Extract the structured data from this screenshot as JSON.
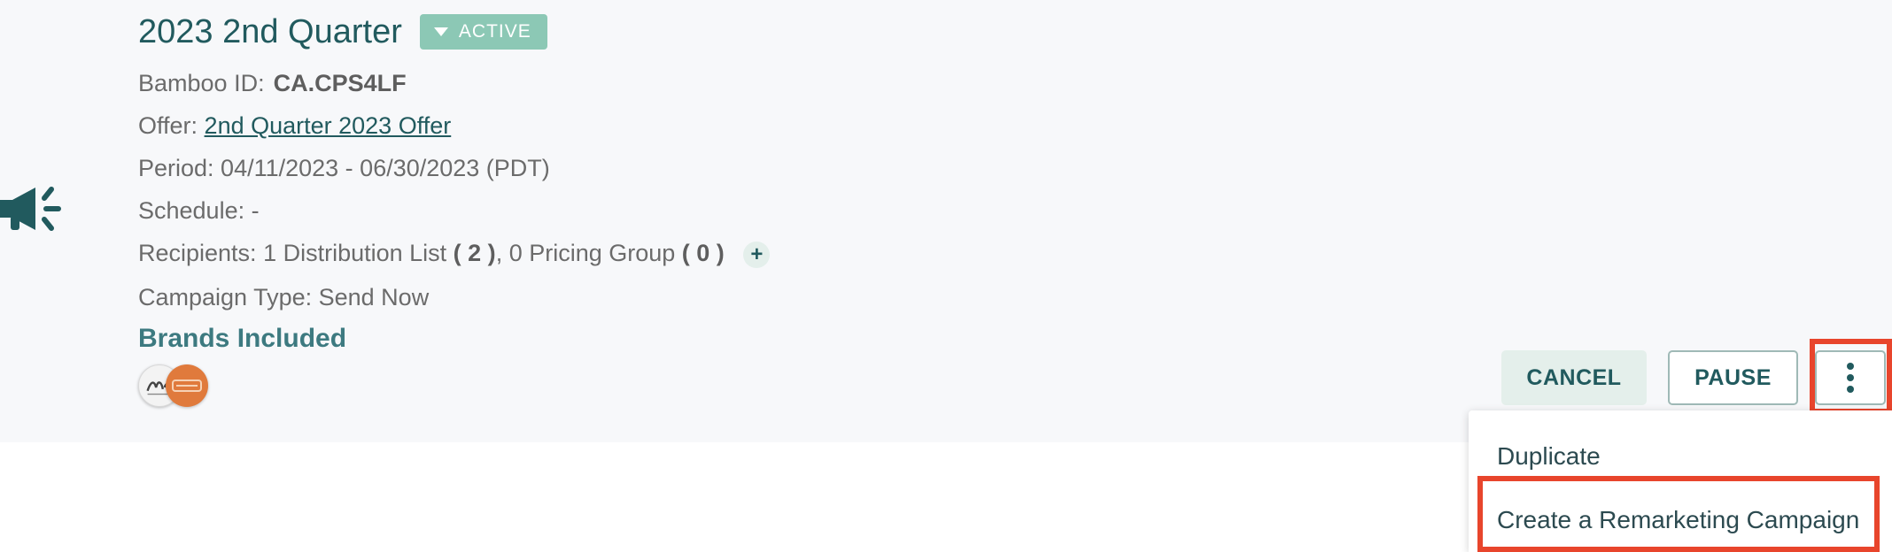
{
  "campaign": {
    "title": "2023 2nd Quarter",
    "status": "ACTIVE",
    "bamboo_id_label": "Bamboo ID:",
    "bamboo_id": "CA.CPS4LF",
    "offer_label": "Offer:",
    "offer_link": "2nd Quarter 2023 Offer",
    "period": "Period: 04/11/2023 - 06/30/2023 (PDT)",
    "schedule": "Schedule: -",
    "recipients_prefix": "Recipients: 1 Distribution List",
    "recipients_dl_count": "( 2 )",
    "recipients_middle": ", 0 Pricing Group",
    "recipients_pg_count": "( 0 )",
    "add_recipients_symbol": "+",
    "campaign_type": "Campaign Type: Send Now",
    "brands_heading": "Brands Included"
  },
  "actions": {
    "cancel_label": "CANCEL",
    "pause_label": "PAUSE"
  },
  "menu": {
    "items": [
      {
        "label": "Duplicate"
      },
      {
        "label": "Create a Remarketing Campaign"
      }
    ]
  },
  "icons": {
    "campaign": "megaphone-icon",
    "status": "caret-down-icon",
    "more": "kebab-menu-icon",
    "add": "plus-icon",
    "annotation": "arrow-icon"
  },
  "colors": {
    "primary": "#215a5e",
    "badge_bg": "#8cc8b5",
    "card_bg": "#f7f8fa",
    "highlight": "#e8452c",
    "secondary_btn_bg": "#e4efeb"
  }
}
